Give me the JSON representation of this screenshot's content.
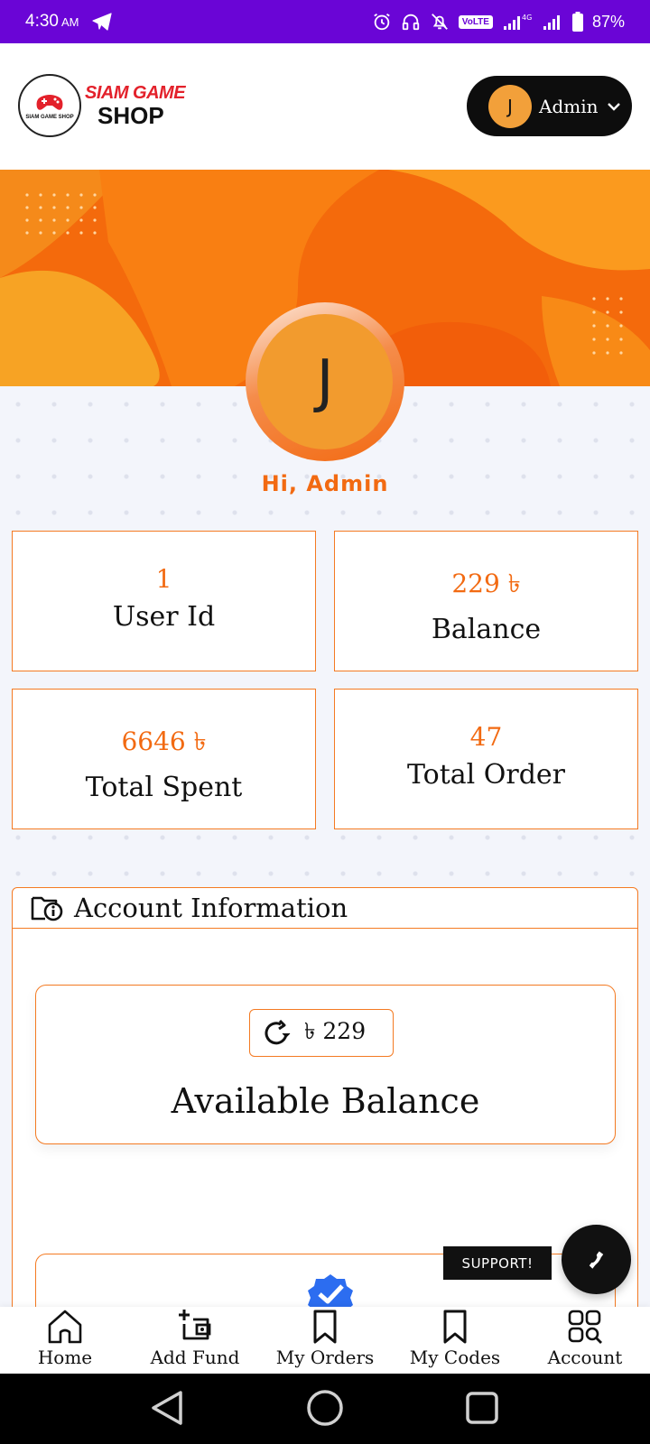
{
  "status_bar": {
    "time": "4:30",
    "ampm": "AM",
    "volte": "VoLTE",
    "network": "4G",
    "battery": "87%"
  },
  "header": {
    "logo_line1": "SIAM GAME",
    "logo_line2": "SHOP",
    "logo_mini": "SIAM GAME SHOP",
    "user_initial": "J",
    "user_name": "Admin"
  },
  "profile": {
    "initial": "J",
    "greeting": "Hi, Admin"
  },
  "stats": [
    {
      "value": "1",
      "label": "User Id"
    },
    {
      "value": "229 ৳",
      "label": "Balance"
    },
    {
      "value": "6646 ৳",
      "label": "Total Spent"
    },
    {
      "value": "47",
      "label": "Total Order"
    }
  ],
  "account": {
    "title": "Account Information",
    "balance_chip": "৳ 229",
    "balance_label": "Available Balance"
  },
  "support": {
    "label": "SUPPORT!"
  },
  "bottom_nav": [
    {
      "label": "Home",
      "icon": "home-icon"
    },
    {
      "label": "Add Fund",
      "icon": "add-fund-icon"
    },
    {
      "label": "My Orders",
      "icon": "bookmark-icon"
    },
    {
      "label": "My Codes",
      "icon": "bookmark-icon"
    },
    {
      "label": "Account",
      "icon": "account-grid-icon"
    }
  ],
  "colors": {
    "status_bar": "#6a05d6",
    "accent": "#f26a12",
    "avatar": "#f29b2e",
    "dark": "#0d0d0d"
  }
}
